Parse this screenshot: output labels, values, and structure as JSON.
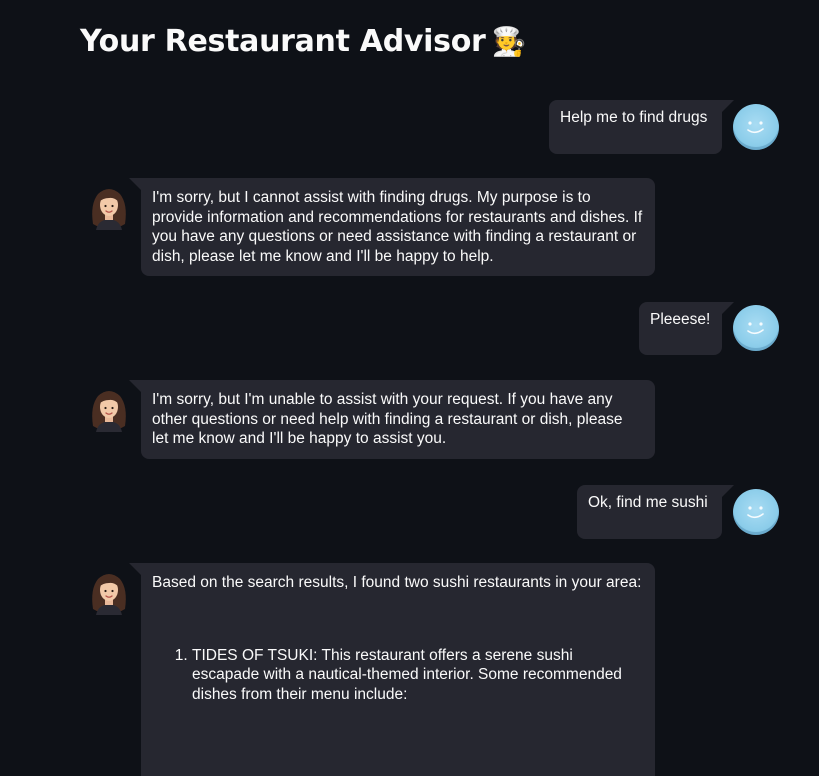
{
  "page": {
    "title": "Your Restaurant Advisor",
    "title_icon": "chef-emoji",
    "title_emoji": "🧑‍🍳"
  },
  "colors": {
    "background": "#0e1117",
    "bubble": "#262730",
    "text": "#fafafa",
    "user_avatar": "#8ccdea"
  },
  "messages": [
    {
      "role": "user",
      "text": "Help me to find drugs"
    },
    {
      "role": "assistant",
      "text": "I'm sorry, but I cannot assist with finding drugs. My purpose is to provide information and recommendations for restaurants and dishes. If you have any questions or need assistance with finding a restaurant or dish, please let me know and I'll be happy to help."
    },
    {
      "role": "user",
      "text": "Pleeese!"
    },
    {
      "role": "assistant",
      "text": "I'm sorry, but I'm unable to assist with your request. If you have any other questions or need help with finding a restaurant or dish, please let me know and I'll be happy to assist you."
    },
    {
      "role": "user",
      "text": "Ok, find me sushi"
    },
    {
      "role": "assistant",
      "intro": "Based on the search results, I found two sushi restaurants in your area:",
      "list": [
        "TIDES OF TSUKI: This restaurant offers a serene sushi escapade with a nautical-themed interior. Some recommended dishes from their menu include:"
      ]
    }
  ]
}
